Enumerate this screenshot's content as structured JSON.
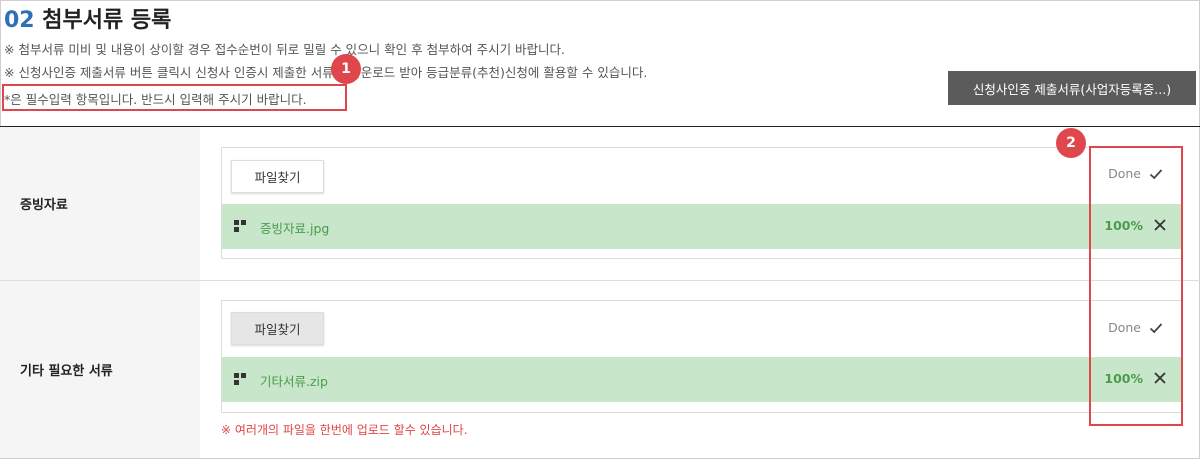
{
  "section": {
    "number": "02",
    "title": "첨부서류 등록"
  },
  "notes": [
    "※ 첨부서류 미비 및 내용이 상이할 경우 접수순번이 뒤로 밀릴 수 있으니 확인 후 첨부하여 주시기 바랍니다.",
    "※ 신청사인증 제출서류 버튼 클릭시 신청사 인증시 제출한 서류를 다운로드 받아 등급분류(추천)신청에 활용할 수 있습니다.",
    "*은 필수입력 항목입니다. 반드시 입력해 주시기 바랍니다."
  ],
  "cert_button_label": "신청사인증 제출서류(사업자등록증...)",
  "annotations": {
    "badge1": "1",
    "badge2": "2"
  },
  "rows": [
    {
      "label": "증빙자료",
      "find_button": "파일찾기",
      "status": "Done",
      "file": {
        "name": "증빙자료.jpg",
        "progress": "100%"
      }
    },
    {
      "label": "기타 필요한 서류",
      "find_button": "파일찾기",
      "status": "Done",
      "file": {
        "name": "기타서류.zip",
        "progress": "100%"
      },
      "note": "※ 여러개의 파일을 한번에 업로드 할수 있습니다."
    }
  ],
  "colors": {
    "accent_blue": "#2f6fb8",
    "annotation_red": "#e0474c",
    "file_bar_green": "#c8e6c9",
    "file_text_green": "#4a9b4f",
    "button_dark": "#5b5b5b"
  },
  "icons": {
    "check": "check-icon",
    "remove": "close-icon",
    "drag": "drag-handle-icon"
  }
}
